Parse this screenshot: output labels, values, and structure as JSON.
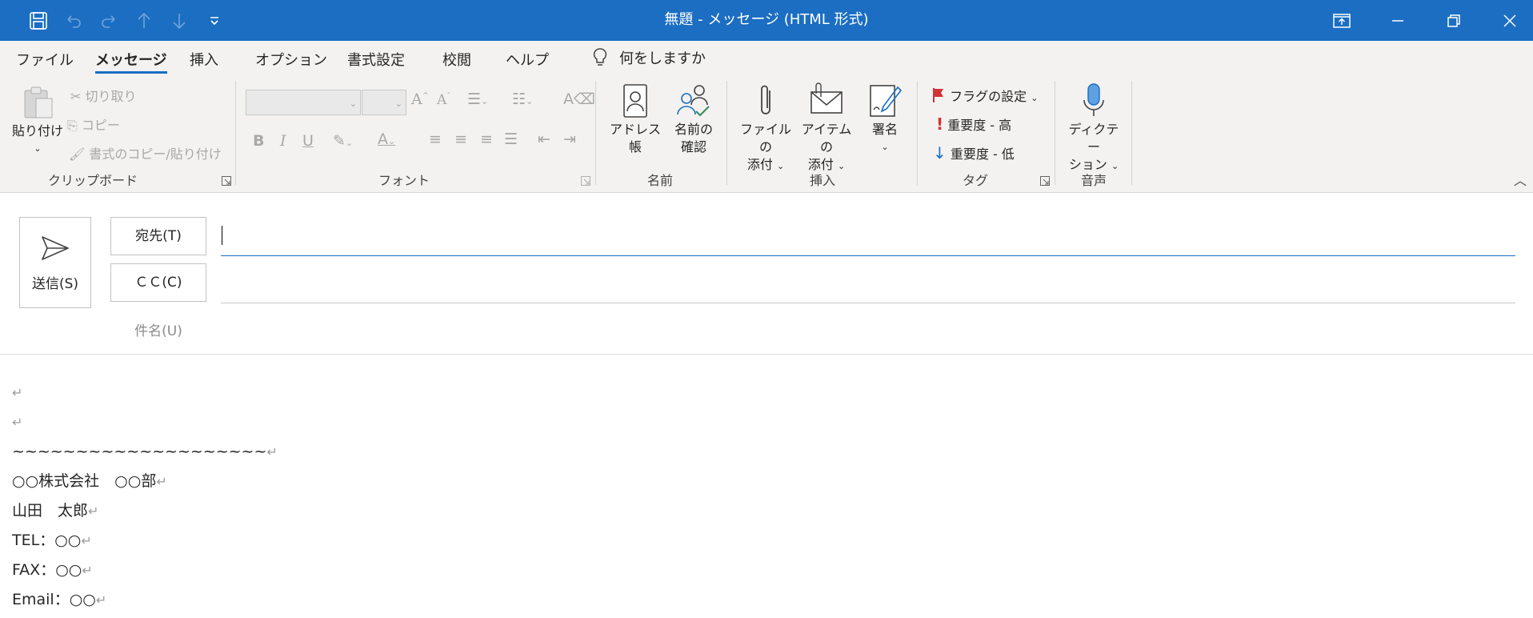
{
  "window": {
    "title": "無題  -  メッセージ (HTML 形式)"
  },
  "quick_access": {
    "icons": [
      "save-icon",
      "undo-icon",
      "redo-icon",
      "up-arrow-icon",
      "down-arrow-icon",
      "customize-dropdown-icon"
    ]
  },
  "menu": {
    "tabs": [
      "ファイル",
      "メッセージ",
      "挿入",
      "オプション",
      "書式設定",
      "校閲",
      "ヘルプ"
    ],
    "active": "メッセージ",
    "tell_me": "何をしますか"
  },
  "ribbon": {
    "clipboard": {
      "paste": "貼り付け",
      "cut": "切り取り",
      "copy": "コピー",
      "format_painter": "書式のコピー/貼り付け",
      "label": "クリップボード"
    },
    "font": {
      "label": "フォント",
      "bold": "B",
      "italic": "I",
      "underline": "U"
    },
    "names": {
      "address_book": "アドレス帳",
      "check_names_1": "名前の",
      "check_names_2": "確認",
      "label": "名前"
    },
    "include": {
      "attach_file_1": "ファイルの",
      "attach_file_2": "添付",
      "attach_item_1": "アイテムの",
      "attach_item_2": "添付",
      "signature": "署名",
      "label": "挿入"
    },
    "tags": {
      "flag": "フラグの設定",
      "high": "重要度 - 高",
      "low": "重要度 - 低",
      "label": "タグ"
    },
    "voice": {
      "dictate_1": "ディクテー",
      "dictate_2": "ション",
      "label": "音声"
    }
  },
  "compose": {
    "send": "送信(S)",
    "to": "宛先(T)",
    "cc": "ＣＣ(C)",
    "subject": "件名(U)"
  },
  "body_lines": [
    "",
    "",
    "~~~~~~~~~~~~~~~~~~~~",
    "○○株式会社　○○部",
    "山田　太郎",
    "TEL：○○",
    "FAX：○○",
    "Email：○○"
  ],
  "colors": {
    "titlebar": "#1b6ec2",
    "ribbon_bg": "#f3f2f1",
    "accent": "#1b6ec2",
    "flag_red": "#d13438",
    "importance_low_blue": "#1b6ec2"
  }
}
